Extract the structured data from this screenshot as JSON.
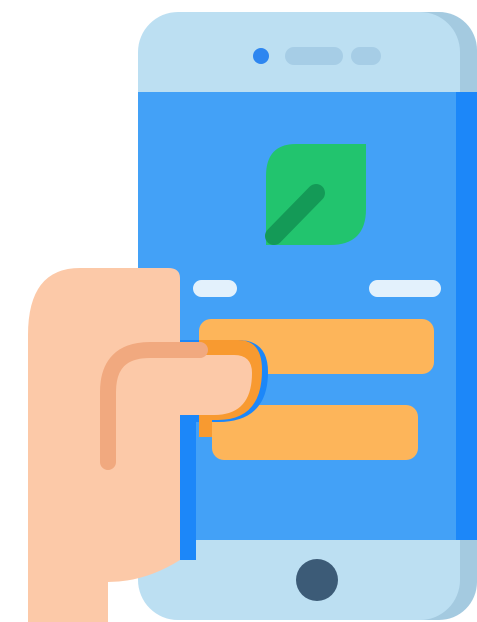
{
  "illustration": {
    "icons": {
      "device": "smartphone-icon",
      "logo": "leaf-icon",
      "hand": "hand-icon",
      "home": "home-button-icon",
      "camera": "camera-icon",
      "speaker": "speaker-grille-icon"
    },
    "colors": {
      "phone_body_light": "#BCDFF2",
      "phone_body_shadow": "#A4CAE0",
      "screen": "#43A1F7",
      "screen_edge": "#1C87F9",
      "camera_dot": "#2E86F0",
      "speaker_slot": "#A6CDE6",
      "leaf": "#22C46E",
      "leaf_vein": "#149A57",
      "label_placeholder": "#E3F1FC",
      "field": "#FDB55A",
      "field_overlap": "#F89A30",
      "skin": "#FCC9A8",
      "skin_shadow": "#F1A97F",
      "home_button": "#3C5B77"
    },
    "screen_content": {
      "label_placeholders": 2,
      "input_fields": 2
    }
  }
}
